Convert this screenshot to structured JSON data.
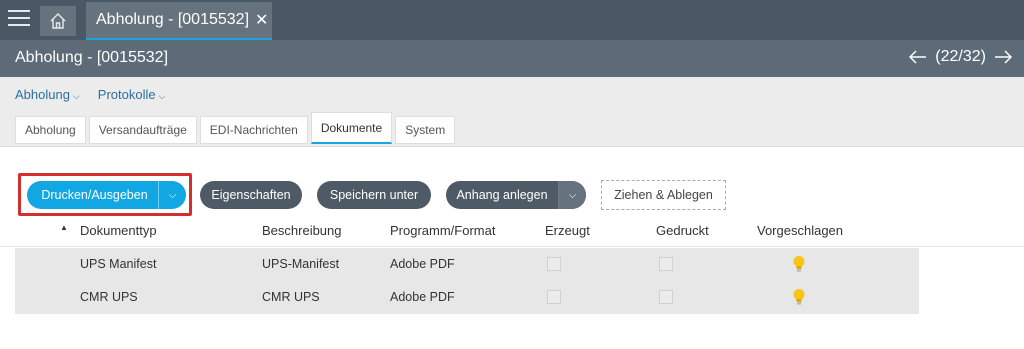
{
  "window": {
    "tab_title": "Abholung - [0015532]",
    "tab_close": "✕"
  },
  "header": {
    "title": "Abholung - [0015532]",
    "pager": "(22/32)"
  },
  "menu": [
    {
      "label": "Abholung"
    },
    {
      "label": "Protokolle"
    }
  ],
  "tabs": [
    {
      "label": "Abholung"
    },
    {
      "label": "Versandaufträge"
    },
    {
      "label": "EDI-Nachrichten"
    },
    {
      "label": "Dokumente",
      "active": true
    },
    {
      "label": "System"
    }
  ],
  "toolbar": {
    "print_label": "Drucken/Ausgeben",
    "properties_label": "Eigenschaften",
    "save_as_label": "Speichern unter",
    "attach_label": "Anhang anlegen",
    "dropzone_label": "Ziehen & Ablegen"
  },
  "table": {
    "columns": [
      "Dokumenttyp",
      "Beschreibung",
      "Programm/Format",
      "Erzeugt",
      "Gedruckt",
      "Vorgeschlagen"
    ],
    "rows": [
      {
        "type": "UPS Manifest",
        "description": "UPS-Manifest",
        "format": "Adobe PDF",
        "created": false,
        "printed": false,
        "suggested": true
      },
      {
        "type": "CMR UPS",
        "description": "CMR UPS",
        "format": "Adobe PDF",
        "created": false,
        "printed": false,
        "suggested": true
      }
    ]
  },
  "colors": {
    "accent": "#12a6e3",
    "highlight": "#d32f2f",
    "topbar": "#4a5866",
    "bulb": "#f5c518"
  }
}
